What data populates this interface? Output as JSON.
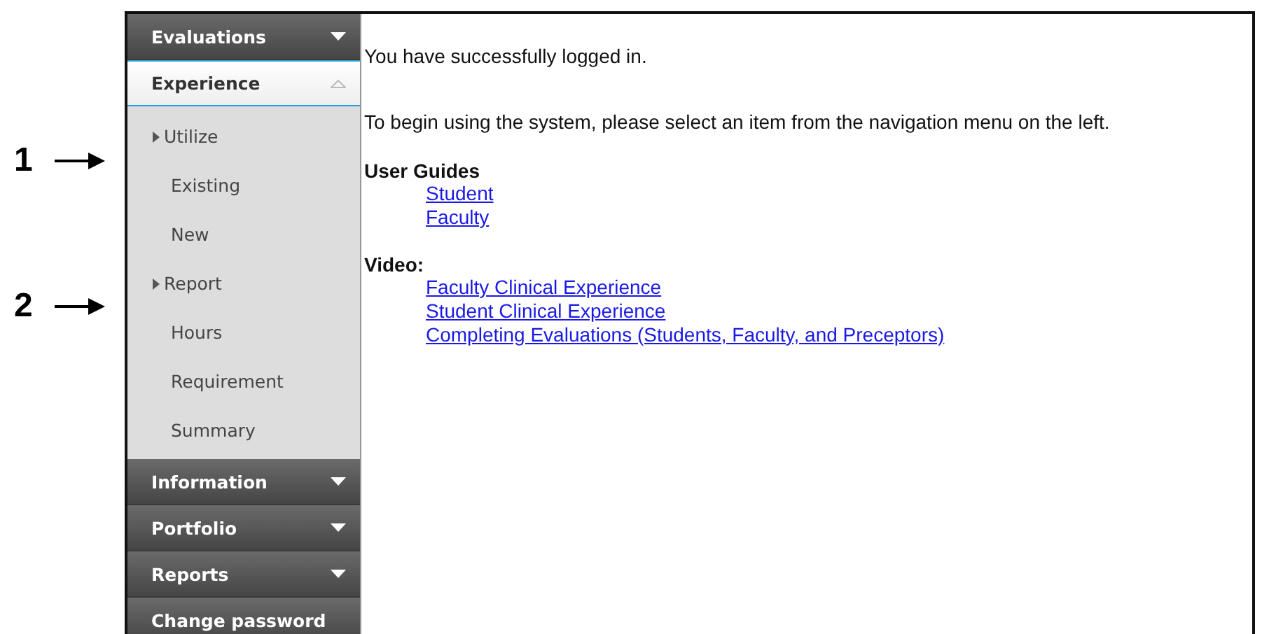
{
  "annotations": [
    {
      "label": "1"
    },
    {
      "label": "2"
    }
  ],
  "nav": [
    {
      "label": "Evaluations",
      "kind": "menu",
      "expanded": false
    },
    {
      "label": "Experience",
      "kind": "menu",
      "expanded": true,
      "children": [
        {
          "label": "Utilize",
          "kind": "group",
          "children": [
            {
              "label": "Existing"
            },
            {
              "label": "New"
            }
          ]
        },
        {
          "label": "Report",
          "kind": "group",
          "children": [
            {
              "label": "Hours"
            },
            {
              "label": "Requirement"
            },
            {
              "label": "Summary"
            }
          ]
        }
      ]
    },
    {
      "label": "Information",
      "kind": "menu",
      "expanded": false
    },
    {
      "label": "Portfolio",
      "kind": "menu",
      "expanded": false
    },
    {
      "label": "Reports",
      "kind": "menu",
      "expanded": false
    },
    {
      "label": "Change password",
      "kind": "link",
      "expanded": false
    }
  ],
  "content": {
    "message": "You have successfully logged in.",
    "instruction": "To begin using the system, please select an item from the navigation menu on the left.",
    "sections": [
      {
        "heading": "User Guides",
        "links": [
          "Student",
          "Faculty"
        ]
      },
      {
        "heading": "Video:",
        "links": [
          "Faculty Clinical Experience",
          "Student Clinical Experience",
          "Completing Evaluations (Students, Faculty, and Preceptors)"
        ]
      }
    ]
  }
}
